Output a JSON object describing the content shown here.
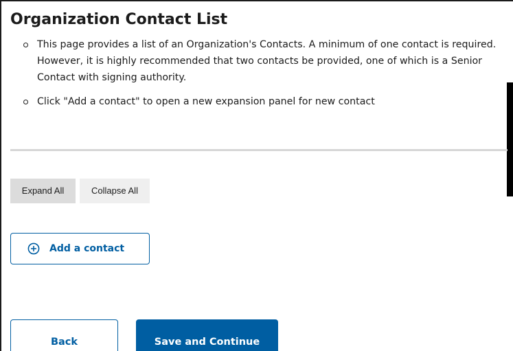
{
  "page": {
    "title": "Organization Contact List"
  },
  "instructions": [
    {
      "text": "This page provides a list of an Organization's Contacts. A minimum of one contact is required. However, it is highly recommended that two contacts be provided, one of which is a Senior Contact with signing authority."
    },
    {
      "text": "Click \"Add a contact\" to open a new expansion panel for new contact"
    }
  ],
  "panel_controls": {
    "expand_all_label": "Expand All",
    "collapse_all_label": "Collapse All"
  },
  "add_contact": {
    "label": "Add a contact",
    "icon": "plus-circle-icon"
  },
  "footer": {
    "back_label": "Back",
    "save_label": "Save and Continue"
  },
  "colors": {
    "primary": "#005ea2",
    "text": "#1b1b1b",
    "divider": "#d6d6d6",
    "expand_button_bg": "#dcdcdc",
    "collapse_button_bg": "#efefef"
  }
}
